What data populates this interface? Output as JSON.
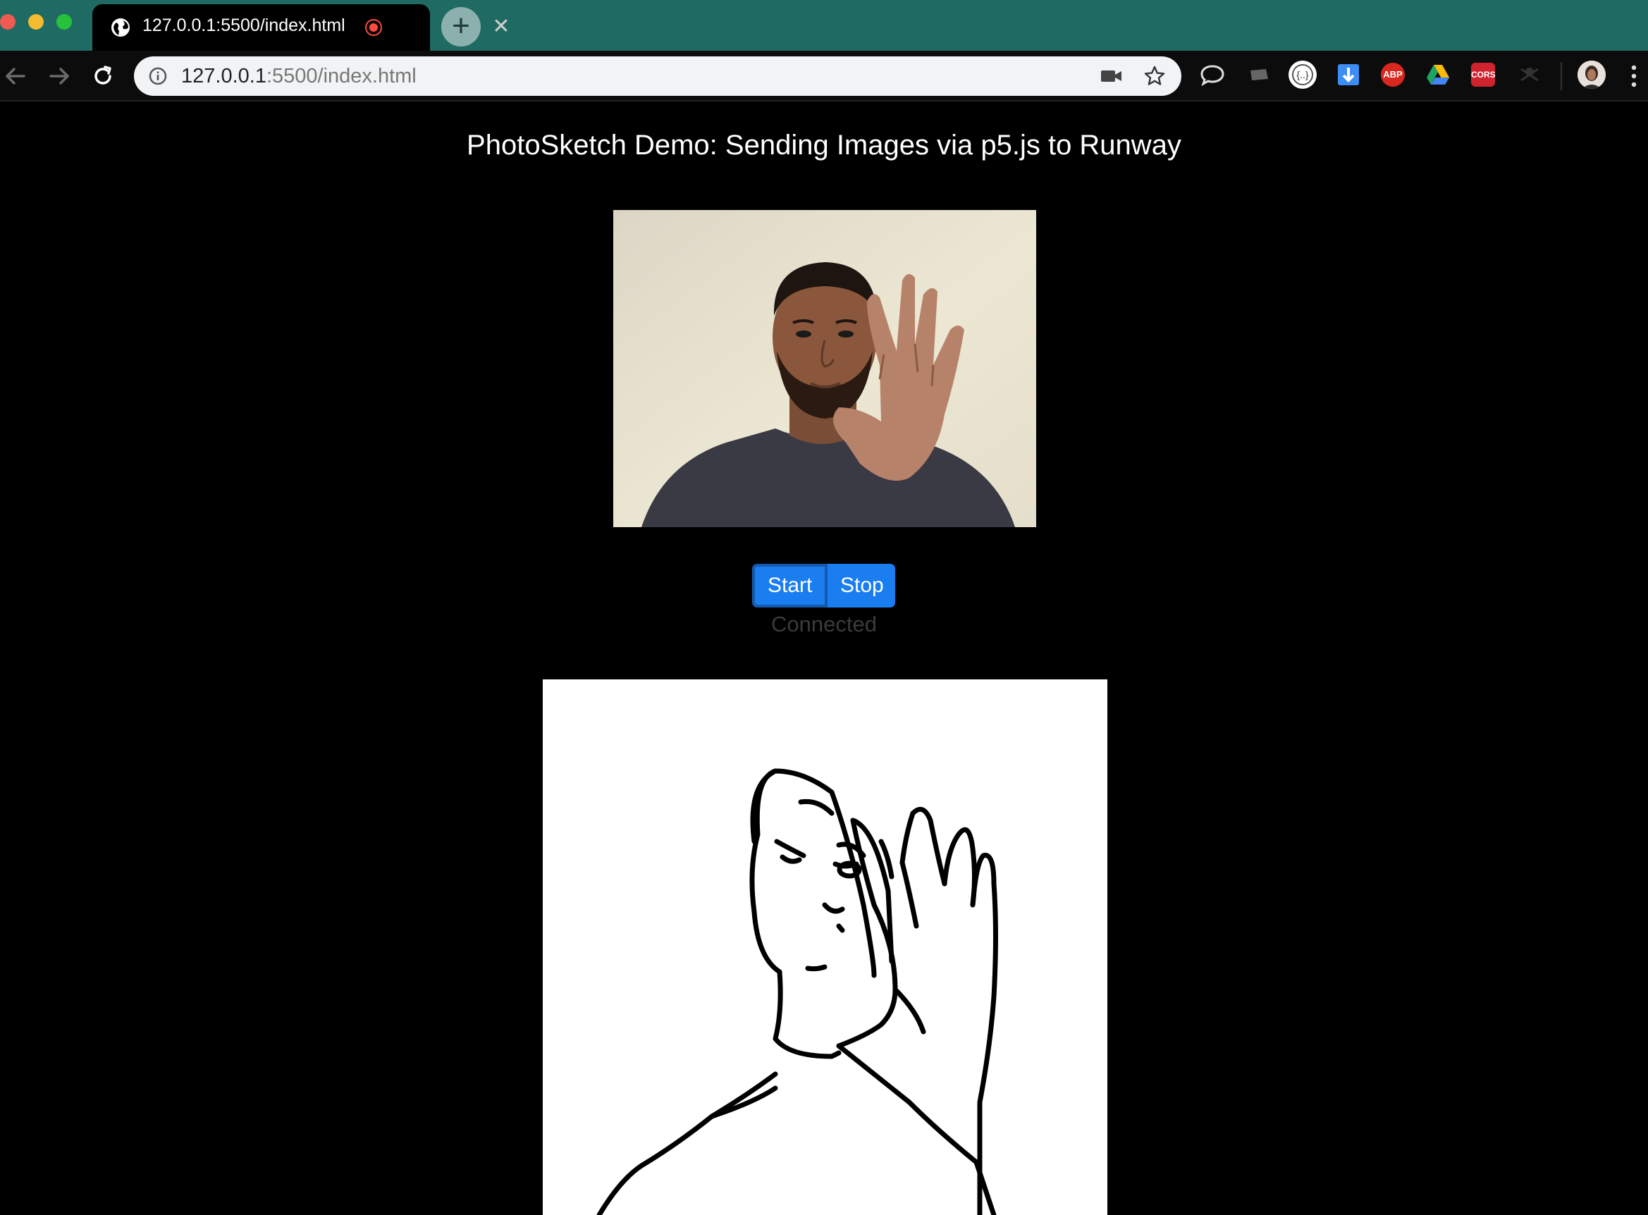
{
  "browser": {
    "tab_title": "127.0.0.1:5500/index.html",
    "new_tab_label": "+",
    "close_label": "✕",
    "url_host": "127.0.0.1",
    "url_rest": ":5500/index.html",
    "extensions": {
      "abp_label": "ABP",
      "cors_label": "CORS"
    }
  },
  "page": {
    "title": "PhotoSketch Demo: Sending Images via p5.js to Runway",
    "start_label": "Start",
    "stop_label": "Stop",
    "status": "Connected"
  },
  "colors": {
    "tabbar": "#1f6b64",
    "button": "#1a7df0",
    "button_border": "#1459ad",
    "status_text": "#3b3b3b"
  }
}
